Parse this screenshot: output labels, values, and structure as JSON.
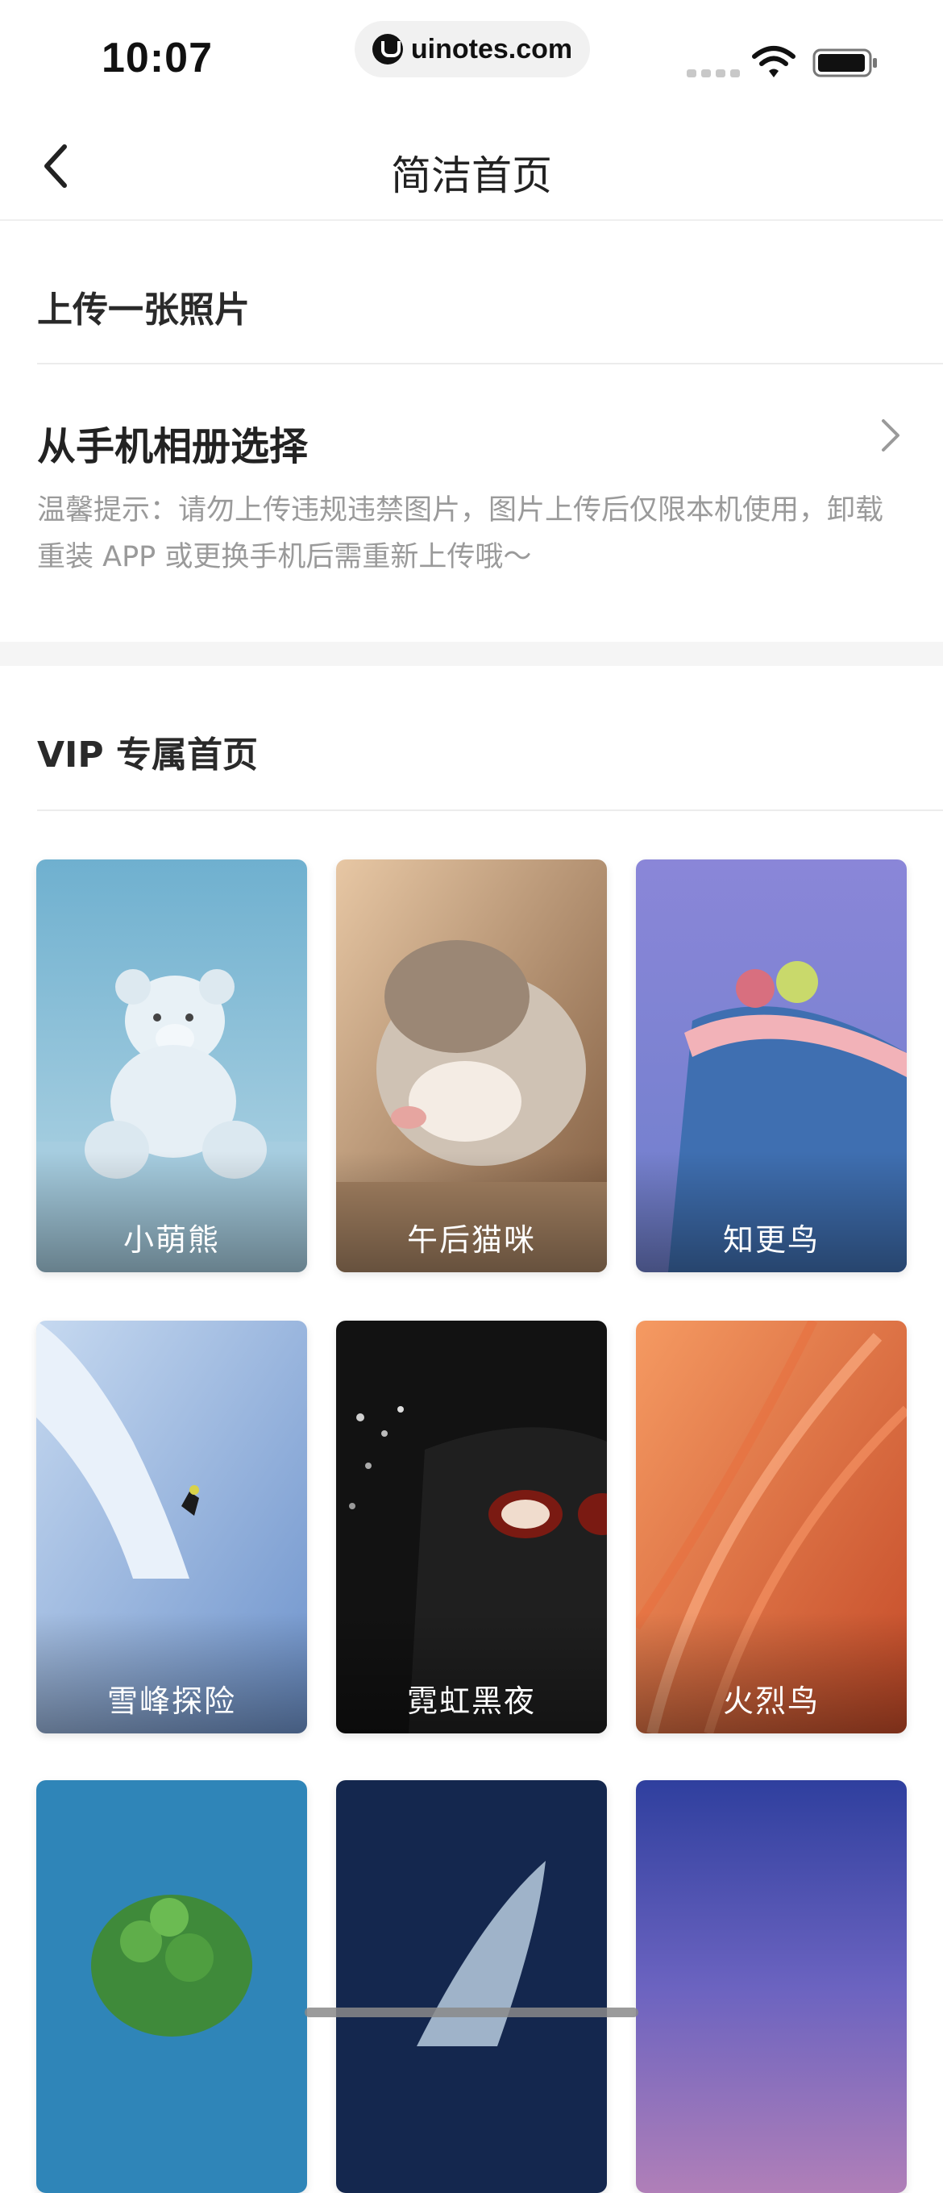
{
  "status_bar": {
    "time": "10:07",
    "url": "uinotes.com",
    "icons": [
      "signal-icon",
      "wifi-icon",
      "battery-icon"
    ]
  },
  "nav": {
    "title": "简洁首页",
    "back_icon": "chevron-left-icon"
  },
  "upload": {
    "title": "上传一张照片",
    "album_label": "从手机相册选择",
    "tip": "温馨提示：请勿上传违规违禁图片，图片上传后仅限本机使用，卸载重装 APP 或更换手机后需重新上传哦～"
  },
  "vip": {
    "title": "VIP 专属首页",
    "cards": [
      {
        "label": "小萌熊",
        "colors": [
          "#7fb7d1",
          "#a9d0e0"
        ]
      },
      {
        "label": "午后猫咪",
        "colors": [
          "#d9b08a",
          "#8e6a4b"
        ]
      },
      {
        "label": "知更鸟",
        "colors": [
          "#8b86d6",
          "#3e6fb0"
        ]
      },
      {
        "label": "雪峰探险",
        "colors": [
          "#9ec0e6",
          "#5f86c6"
        ]
      },
      {
        "label": "霓虹黑夜",
        "colors": [
          "#2a2a2a",
          "#0c0c0c"
        ]
      },
      {
        "label": "火烈鸟",
        "colors": [
          "#f08a54",
          "#c9502c"
        ]
      },
      {
        "label": "",
        "colors": [
          "#2f86b8",
          "#1d6ca0"
        ]
      },
      {
        "label": "",
        "colors": [
          "#172a55",
          "#0b1530"
        ]
      },
      {
        "label": "",
        "colors": [
          "#3f4fb0",
          "#8a6fc0"
        ]
      }
    ]
  }
}
